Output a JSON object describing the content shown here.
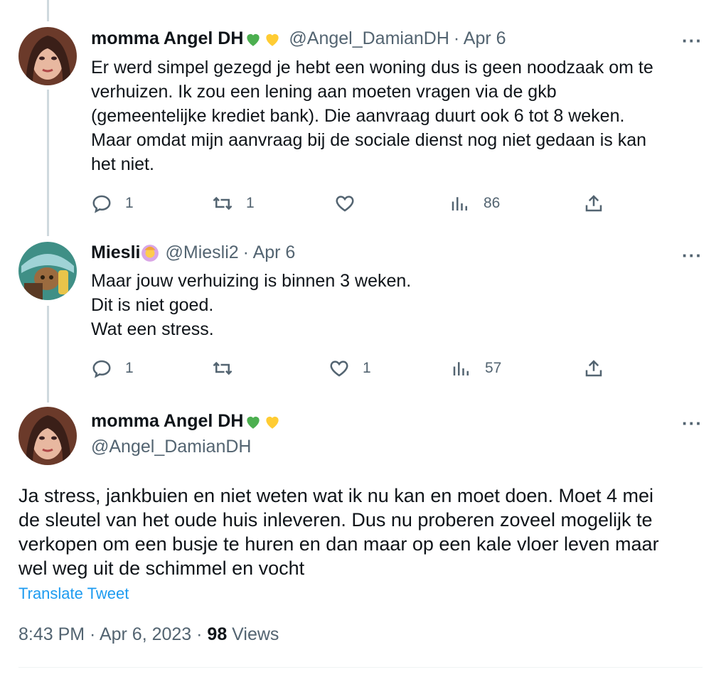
{
  "tweets": [
    {
      "name": "momma Angel DH",
      "handle": "@Angel_DamianDH",
      "date": "· Apr 6",
      "more": "···",
      "text": "Er werd simpel gezegd je hebt een woning dus is geen noodzaak om te\nverhuizen. Ik zou een lening aan moeten vragen via de gkb\n(gemeentelijke krediet bank). Die aanvraag duurt ook 6 tot 8 weken.\nMaar omdat mijn aanvraag bij de sociale dienst nog niet gedaan is kan\nhet niet.",
      "replies": "1",
      "retweets": "1",
      "likes": "",
      "views": "86"
    },
    {
      "name": "Miesli",
      "handle": "@Miesli2",
      "date": "· Apr 6",
      "more": "···",
      "text": "Maar jouw verhuizing is  binnen 3 weken.\nDit is niet goed.\nWat een stress.",
      "replies": "1",
      "retweets": "",
      "likes": "1",
      "views": "57"
    }
  ],
  "main_tweet": {
    "name": "momma Angel DH",
    "handle": "@Angel_DamianDH",
    "more": "···",
    "text": "Ja stress, jankbuien en niet weten wat ik nu kan en moet doen. Moet 4 mei\nde sleutel van het oude huis inleveren. Dus nu proberen zoveel mogelijk te\nverkopen om een busje te huren en dan maar op een kale vloer leven maar\nwel weg uit de schimmel en vocht",
    "translate": "Translate Tweet",
    "time": "8:43 PM · Apr 6, 2023 · ",
    "views_count": "98",
    "views_label": " Views"
  },
  "colors": {
    "text": "#0f1419",
    "secondary": "#536471",
    "link": "#1d9bf0",
    "thread_line": "#cfd9de",
    "green_heart": "#4caf50",
    "yellow_heart": "#ffcc33"
  },
  "icons": [
    "reply-icon",
    "retweet-icon",
    "like-icon",
    "views-icon",
    "share-icon",
    "more-icon",
    "green-heart-icon",
    "yellow-heart-icon",
    "woman-gesturing-icon"
  ]
}
